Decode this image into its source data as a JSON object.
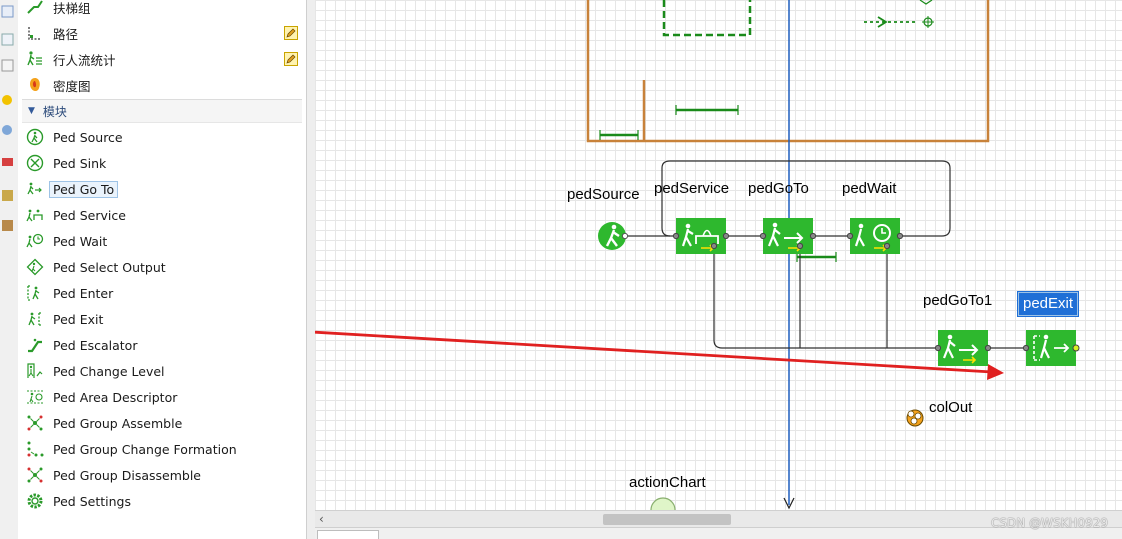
{
  "palette": {
    "top_items": [
      {
        "label": "扶梯组",
        "icon": "escalator-group-icon",
        "has_edit": false
      },
      {
        "label": "路径",
        "icon": "path-icon",
        "has_edit": true
      },
      {
        "label": "行人流统计",
        "icon": "ped-flow-stats-icon",
        "has_edit": true
      },
      {
        "label": "密度图",
        "icon": "density-map-icon",
        "has_edit": false
      }
    ],
    "section_title": "模块",
    "modules": [
      {
        "label": "Ped Source",
        "icon": "ped-source-icon"
      },
      {
        "label": "Ped Sink",
        "icon": "ped-sink-icon"
      },
      {
        "label": "Ped Go To",
        "icon": "ped-goto-icon"
      },
      {
        "label": "Ped Service",
        "icon": "ped-service-icon"
      },
      {
        "label": "Ped Wait",
        "icon": "ped-wait-icon"
      },
      {
        "label": "Ped Select Output",
        "icon": "ped-select-output-icon"
      },
      {
        "label": "Ped Enter",
        "icon": "ped-enter-icon"
      },
      {
        "label": "Ped Exit",
        "icon": "ped-exit-icon"
      },
      {
        "label": "Ped Escalator",
        "icon": "ped-escalator-icon"
      },
      {
        "label": "Ped Change Level",
        "icon": "ped-change-level-icon"
      },
      {
        "label": "Ped Area Descriptor",
        "icon": "ped-area-descriptor-icon"
      },
      {
        "label": "Ped Group Assemble",
        "icon": "ped-group-assemble-icon"
      },
      {
        "label": "Ped Group Change Formation",
        "icon": "ped-group-change-formation-icon"
      },
      {
        "label": "Ped Group Disassemble",
        "icon": "ped-group-disassemble-icon"
      },
      {
        "label": "Ped Settings",
        "icon": "ped-settings-icon"
      }
    ],
    "selected_module": "Ped Go To"
  },
  "diagram": {
    "blocks": {
      "pedSource": "pedSource",
      "pedService": "pedService",
      "pedGoTo": "pedGoTo",
      "pedWait": "pedWait",
      "pedGoTo1": "pedGoTo1",
      "pedExit": "pedExit",
      "colOut": "colOut",
      "actionChart": "actionChart"
    },
    "selected_block": "pedExit"
  },
  "watermark": "CSDN @WSKH0929",
  "colors": {
    "block_green": "#2eb82e",
    "wall_brown": "#c8823a",
    "arrow_red": "#e02020",
    "axis_blue": "#1f5fbf",
    "connector": "#303030"
  }
}
